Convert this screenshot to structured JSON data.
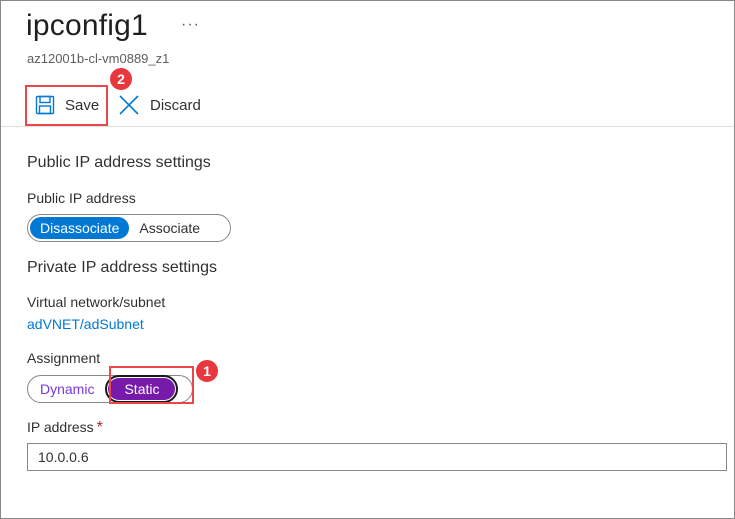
{
  "header": {
    "title": "ipconfig1",
    "more_label": "···",
    "subtitle": "az12001b-cl-vm0889_z1"
  },
  "toolbar": {
    "save_label": "Save",
    "discard_label": "Discard",
    "save_badge": "2"
  },
  "public_ip": {
    "heading": "Public IP address settings",
    "field_label": "Public IP address",
    "options": [
      "Disassociate",
      "Associate"
    ],
    "selected": "Disassociate"
  },
  "private_ip": {
    "heading": "Private IP address settings",
    "vnet_label": "Virtual network/subnet",
    "vnet_value": "adVNET/adSubnet",
    "assignment_label": "Assignment",
    "assignment_options": [
      "Dynamic",
      "Static"
    ],
    "assignment_selected": "Static",
    "assignment_badge": "1",
    "ip_label": "IP address",
    "ip_required_mark": "*",
    "ip_value": "10.0.0.6"
  },
  "colors": {
    "accent": "#0078d4",
    "static_selected": "#7719aa",
    "highlight": "#e8484a"
  }
}
